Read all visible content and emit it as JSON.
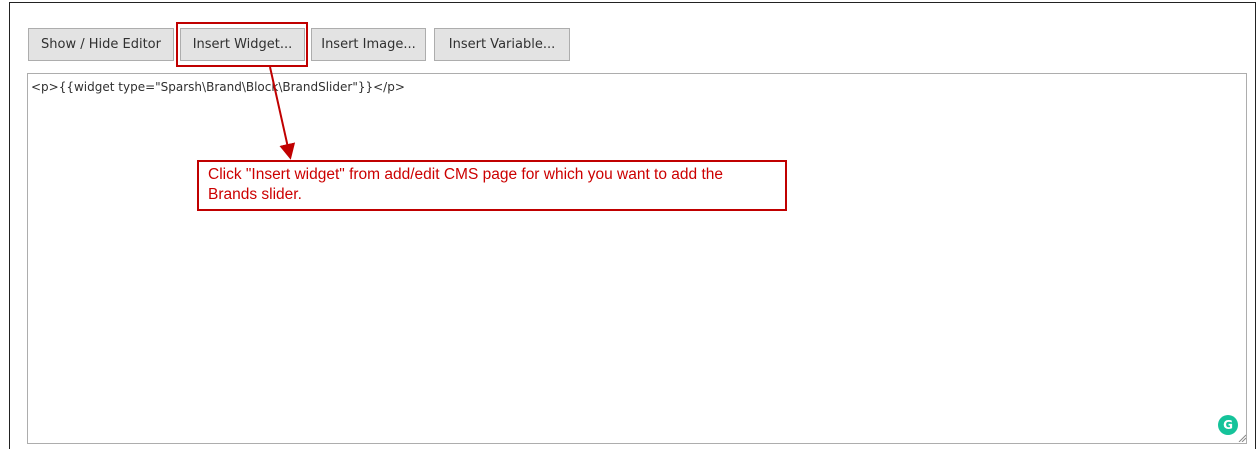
{
  "toolbar": {
    "show_hide_editor": "Show / Hide Editor",
    "insert_widget": "Insert Widget...",
    "insert_image": "Insert Image...",
    "insert_variable": "Insert Variable..."
  },
  "editor": {
    "content": "<p>{{widget type=\"Sparsh\\Brand\\Block\\BrandSlider\"}}</p>"
  },
  "annotation": {
    "text": "Click \"Insert widget\" from add/edit CMS page for which you want to add the Brands slider.",
    "color": "#cc0000"
  },
  "icons": {
    "grammarly": "grammarly-icon",
    "grammarly_letter": "G",
    "resize": "resize-handle-icon"
  }
}
